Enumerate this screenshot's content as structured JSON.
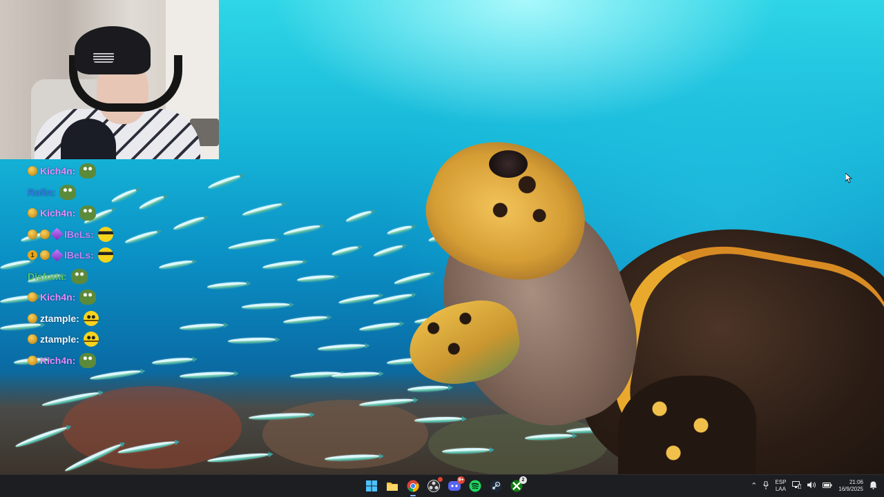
{
  "chat": {
    "messages": [
      {
        "name": "Kich4n:",
        "color": "#e58bff",
        "badges": [
          "gold"
        ],
        "emote": "frog"
      },
      {
        "name": "Rofin:",
        "color": "#3a76e8",
        "badges": [],
        "emote": "frog"
      },
      {
        "name": "Kich4n:",
        "color": "#e58bff",
        "badges": [
          "gold"
        ],
        "emote": "frog"
      },
      {
        "name": "lBeLs:",
        "color": "#c387ff",
        "badges": [
          "gold",
          "gold",
          "purple"
        ],
        "emote": "sunglasses"
      },
      {
        "name": "lBeLs:",
        "color": "#c387ff",
        "badges": [
          "number",
          "gold",
          "purple"
        ],
        "emote": "sunglasses"
      },
      {
        "name": "Disforia:",
        "color": "#58c86a",
        "badges": [],
        "emote": "frog"
      },
      {
        "name": "Kich4n:",
        "color": "#e58bff",
        "badges": [
          "gold"
        ],
        "emote": "frog"
      },
      {
        "name": "ztample:",
        "color": "#f3f7ff",
        "badges": [
          "gold"
        ],
        "emote": "face"
      },
      {
        "name": "ztample:",
        "color": "#f3f7ff",
        "badges": [
          "gold"
        ],
        "emote": "face"
      },
      {
        "name": "Kich4n:",
        "color": "#e58bff",
        "badges": [
          "gold"
        ],
        "emote": "frog"
      }
    ],
    "number_badge": "1"
  },
  "taskbar": {
    "apps": [
      {
        "name": "start-button",
        "icon": "windows-logo-icon"
      },
      {
        "name": "file-explorer",
        "icon": "folder-icon"
      },
      {
        "name": "chrome",
        "icon": "chrome-icon",
        "active": true
      },
      {
        "name": "obs",
        "icon": "obs-icon",
        "badge": ""
      },
      {
        "name": "discord",
        "icon": "discord-icon",
        "badge": "9+"
      },
      {
        "name": "spotify",
        "icon": "spotify-icon"
      },
      {
        "name": "steam",
        "icon": "steam-icon"
      },
      {
        "name": "xbox",
        "icon": "xbox-icon",
        "badge": "2"
      }
    ],
    "tray": {
      "lang_top": "ESP",
      "lang_bottom": "LAA",
      "time": "21:06",
      "date": "16/9/2025"
    }
  },
  "colors": {
    "taskbar_bg": "#1d1e22",
    "water_light": "#2fd6e6",
    "water_deep": "#0a6fa8"
  }
}
